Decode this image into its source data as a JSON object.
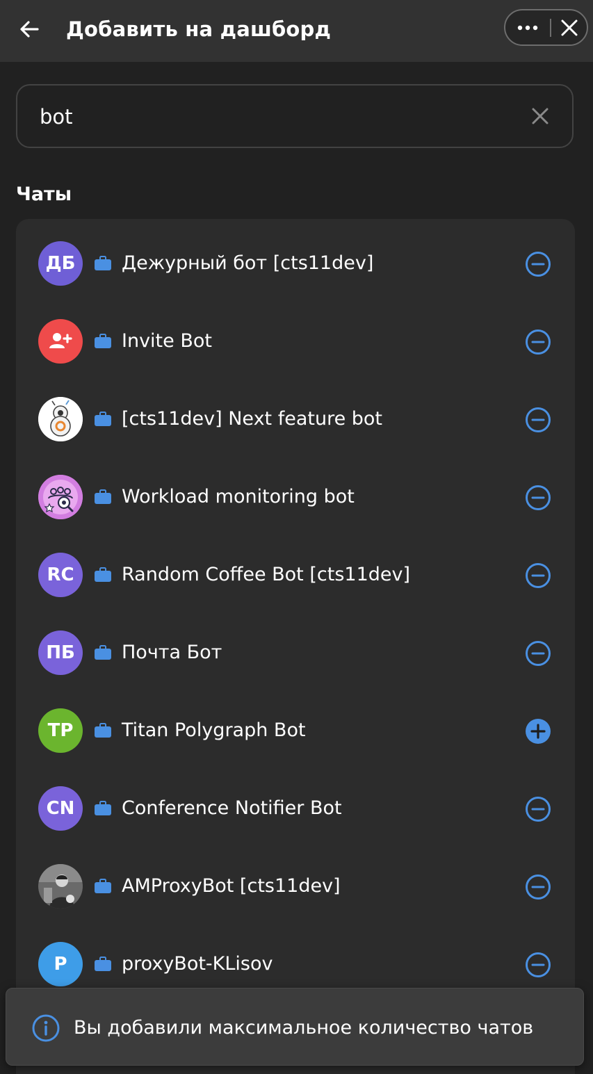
{
  "header": {
    "title": "Добавить на дашборд",
    "back_icon": "arrow-left-icon",
    "more_icon": "more-horizontal-icon",
    "close_icon": "close-icon"
  },
  "search": {
    "value": "bot",
    "clear_icon": "clear-icon"
  },
  "section": {
    "title": "Чаты"
  },
  "colors": {
    "accent": "#4a90e2",
    "background": "#212121",
    "card": "#2c2c2c",
    "header": "#323232"
  },
  "chats": [
    {
      "name": "Дежурный бот [cts11dev]",
      "initials": "ДБ",
      "avatar_type": "initials",
      "avatar_color": "#6f5fd6",
      "action": "remove"
    },
    {
      "name": "Invite Bot",
      "initials": "",
      "avatar_type": "add-user-icon",
      "avatar_color": "#ef4b4b",
      "action": "remove"
    },
    {
      "name": "[cts11dev] Next feature bot",
      "initials": "",
      "avatar_type": "robot-image",
      "avatar_color": "#ffffff",
      "action": "remove"
    },
    {
      "name": "Workload monitoring bot",
      "initials": "",
      "avatar_type": "team-monitor-image",
      "avatar_color": "#d980e6",
      "action": "remove"
    },
    {
      "name": "Random Coffee Bot [cts11dev]",
      "initials": "RC",
      "avatar_type": "initials",
      "avatar_color": "#7a63da",
      "action": "remove"
    },
    {
      "name": "Почта Бот",
      "initials": "ПБ",
      "avatar_type": "initials",
      "avatar_color": "#7a63da",
      "action": "remove"
    },
    {
      "name": "Titan Polygraph Bot",
      "initials": "TP",
      "avatar_type": "initials",
      "avatar_color": "#6bb52e",
      "action": "add"
    },
    {
      "name": "Conference Notifier Bot",
      "initials": "CN",
      "avatar_type": "initials",
      "avatar_color": "#7a63da",
      "action": "remove"
    },
    {
      "name": "AMProxyBot [cts11dev]",
      "initials": "",
      "avatar_type": "photo-image",
      "avatar_color": "#555555",
      "action": "remove"
    },
    {
      "name": "proxyBot-KLisov",
      "initials": "P",
      "avatar_type": "initials",
      "avatar_color": "#3e9de8",
      "action": "remove"
    }
  ],
  "toast": {
    "text": "Вы добавили максимальное количество чатов",
    "icon": "info-icon"
  }
}
